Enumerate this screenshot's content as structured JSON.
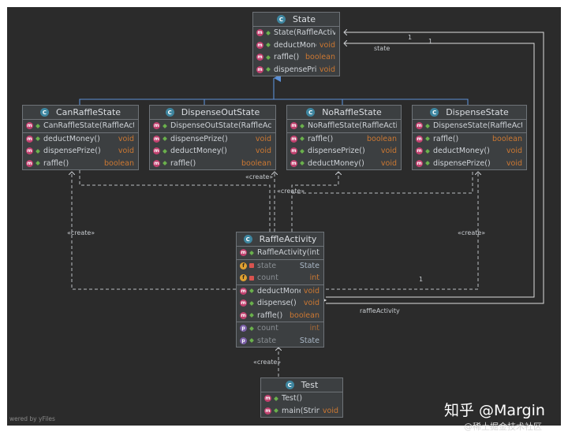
{
  "state_class": {
    "name": "State",
    "members": [
      {
        "name": "State(RaffleActivity)",
        "type": "",
        "kind": "constructor"
      },
      {
        "name": "deductMoney()",
        "type": "void",
        "kind": "method"
      },
      {
        "name": "raffle()",
        "type": "boolean",
        "kind": "method"
      },
      {
        "name": "dispensePrize()",
        "type": "void",
        "kind": "method"
      }
    ]
  },
  "subclasses": [
    {
      "name": "CanRaffleState",
      "ctor": "CanRaffleState(RaffleActivity)",
      "methods": [
        {
          "name": "deductMoney()",
          "type": "void"
        },
        {
          "name": "dispensePrize()",
          "type": "void"
        },
        {
          "name": "raffle()",
          "type": "boolean"
        }
      ]
    },
    {
      "name": "DispenseOutState",
      "ctor": "DispenseOutState(RaffleActivity)",
      "methods": [
        {
          "name": "dispensePrize()",
          "type": "void"
        },
        {
          "name": "deductMoney()",
          "type": "void"
        },
        {
          "name": "raffle()",
          "type": "boolean"
        }
      ]
    },
    {
      "name": "NoRaffleState",
      "ctor": "NoRaffleState(RaffleActivity)",
      "methods": [
        {
          "name": "raffle()",
          "type": "boolean"
        },
        {
          "name": "dispensePrize()",
          "type": "void"
        },
        {
          "name": "deductMoney()",
          "type": "void"
        }
      ]
    },
    {
      "name": "DispenseState",
      "ctor": "DispenseState(RaffleActivity)",
      "methods": [
        {
          "name": "raffle()",
          "type": "boolean"
        },
        {
          "name": "deductMoney()",
          "type": "void"
        },
        {
          "name": "dispensePrize()",
          "type": "void"
        }
      ]
    }
  ],
  "raffle_activity": {
    "name": "RaffleActivity",
    "ctor": {
      "name": "RaffleActivity(int)"
    },
    "fields": [
      {
        "name": "state",
        "type": "State"
      },
      {
        "name": "count",
        "type": "int"
      }
    ],
    "methods": [
      {
        "name": "deductMoney()",
        "type": "void"
      },
      {
        "name": "dispense()",
        "type": "void"
      },
      {
        "name": "raffle()",
        "type": "boolean"
      }
    ],
    "properties": [
      {
        "name": "count",
        "type": "int"
      },
      {
        "name": "state",
        "type": "State"
      }
    ]
  },
  "test_class": {
    "name": "Test",
    "members": [
      {
        "name": "Test()",
        "type": ""
      },
      {
        "name": "main(String[])",
        "type": "void"
      }
    ]
  },
  "labels": {
    "create": "«create»",
    "one": "1",
    "state": "state",
    "raffleActivity": "raffleActivity"
  },
  "watermark": {
    "main": "知乎 @Margin",
    "sub": "@稀土掘金技术社区",
    "yfiles": "wered by yFiles"
  },
  "colors": {
    "canvas": "#2b2b2b",
    "box": "#3c3f41",
    "inherit_line": "#5b8fd6",
    "dep_line": "#b9bcc0",
    "assoc_line": "#dcdcdc",
    "type_color": "#cc7832"
  }
}
